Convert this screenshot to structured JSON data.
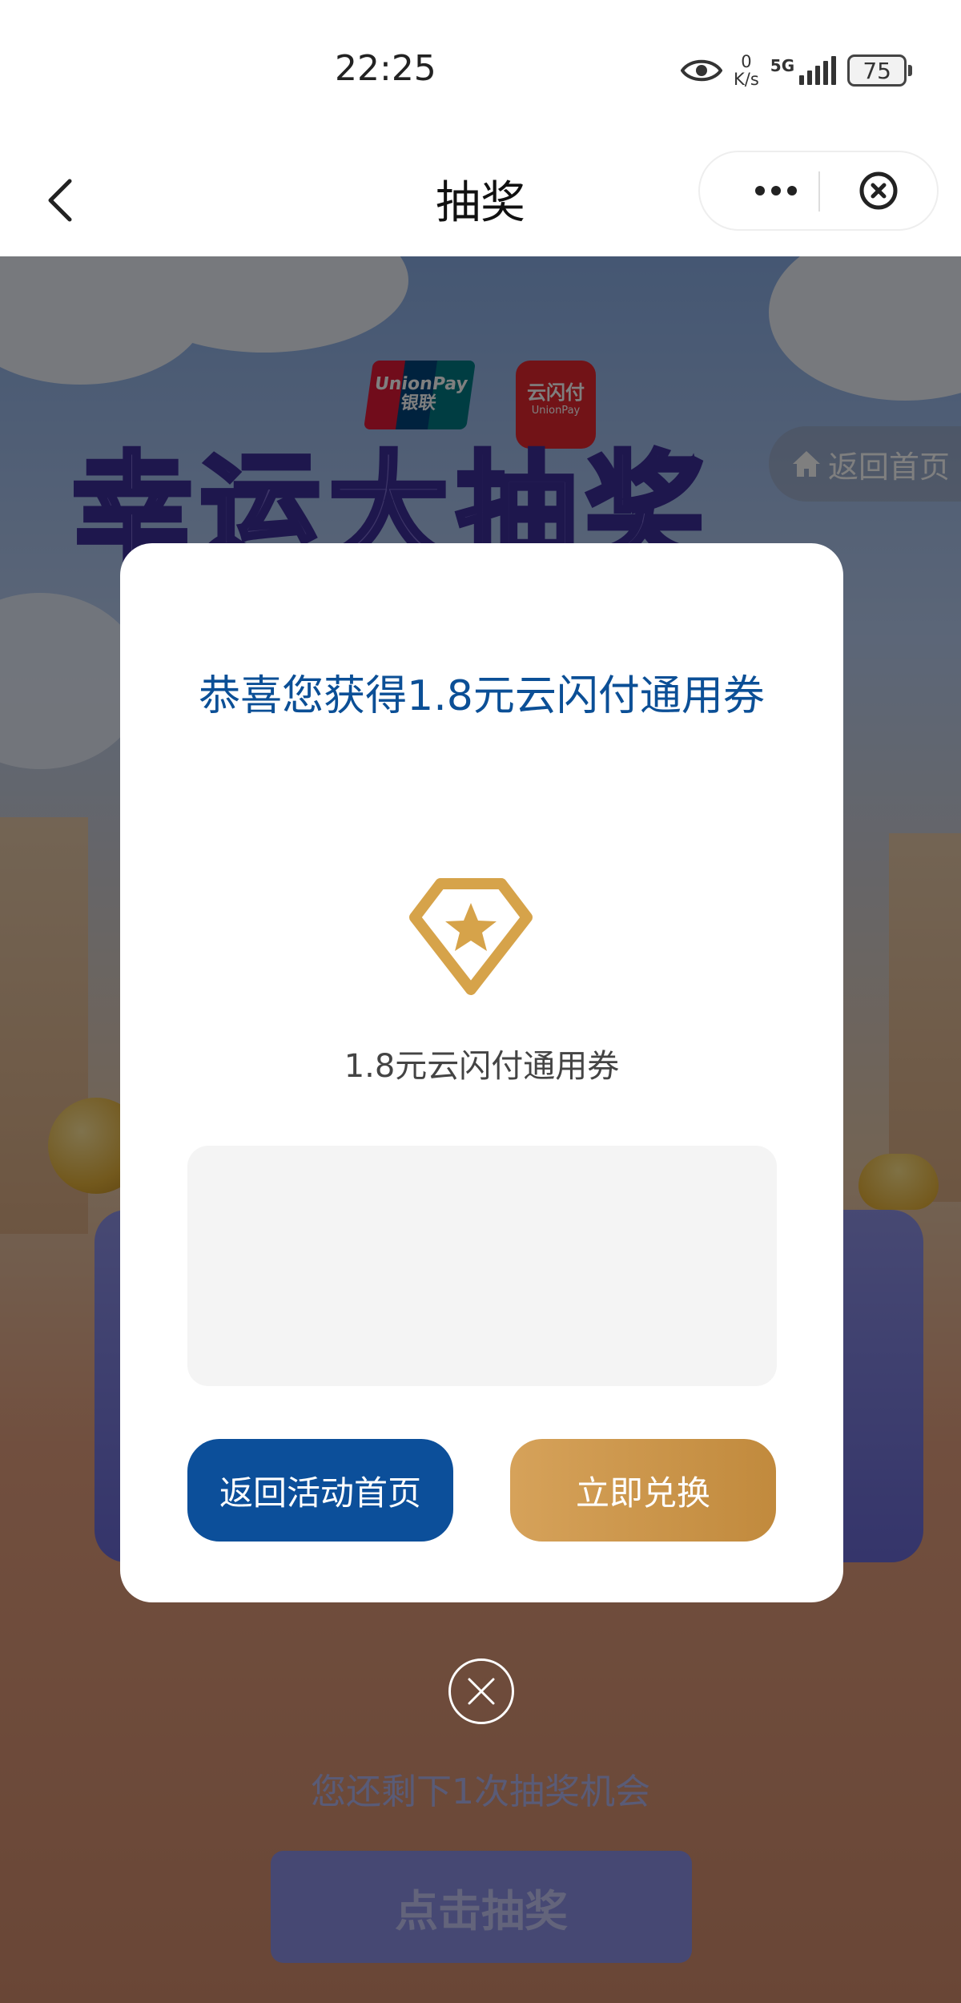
{
  "status_bar": {
    "time": "22:25",
    "net_speed_value": "0",
    "net_speed_unit": "K/s",
    "signal_label": "5G",
    "battery": "75"
  },
  "nav": {
    "title": "抽奖",
    "back_icon": "chevron-left-icon",
    "more_icon": "more-dots-icon",
    "close_icon": "close-circle-icon"
  },
  "background": {
    "banner_title": "幸运大抽奖",
    "unionpay_logo_text": "UnionPay 银联",
    "quickpass_logo_text": "云闪付",
    "quickpass_logo_sub": "UnionPay",
    "back_home_label": "返回首页",
    "remaining_text": "您还剩下1次抽奖机会",
    "draw_button_label": "点击抽奖"
  },
  "modal": {
    "title": "恭喜您获得1.8元云闪付通用券",
    "prize_icon": "diamond-star-icon",
    "prize_name": "1.8元云闪付通用券",
    "back_button_label": "返回活动首页",
    "redeem_button_label": "立即兑换",
    "close_icon": "close-circle-icon"
  },
  "colors": {
    "primary_blue": "#0c4f9a",
    "gold": "#c8913f",
    "title_blue": "#0b4f96"
  }
}
